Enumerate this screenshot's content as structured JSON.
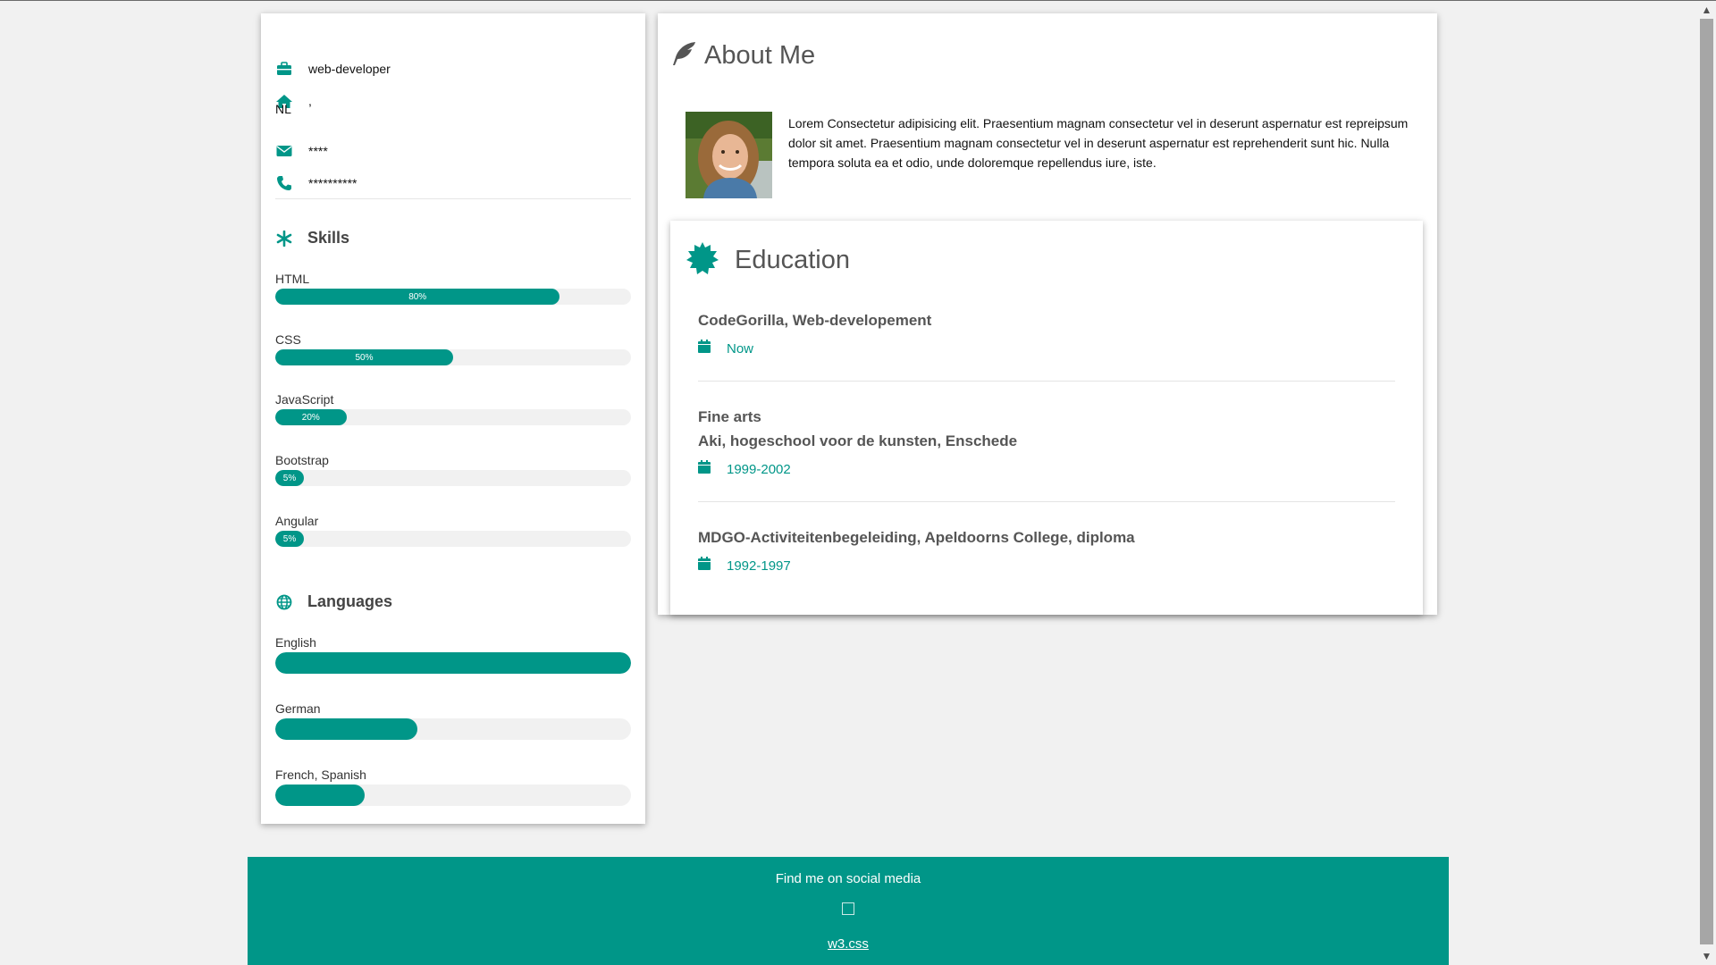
{
  "profile": {
    "job": "web-developer",
    "location_line1": ",",
    "location_line2": "NL",
    "email": "****",
    "phone": "**********"
  },
  "skills": {
    "title": "Skills",
    "items": [
      {
        "label": "HTML",
        "percent": 80,
        "text": "80%"
      },
      {
        "label": "CSS",
        "percent": 50,
        "text": "50%"
      },
      {
        "label": "JavaScript",
        "percent": 20,
        "text": "20%"
      },
      {
        "label": "Bootstrap",
        "percent": 5,
        "text": "5%"
      },
      {
        "label": "Angular",
        "percent": 5,
        "text": "5%"
      }
    ]
  },
  "languages": {
    "title": "Languages",
    "items": [
      {
        "label": "English",
        "percent": 100
      },
      {
        "label": "German",
        "percent": 40
      },
      {
        "label": "French, Spanish",
        "percent": 25
      }
    ]
  },
  "about": {
    "title": "About Me",
    "text": "Lorem Consectetur adipisicing elit. Praesentium magnam consectetur vel in deserunt aspernatur est repreipsum dolor sit amet. Praesentium magnam consectetur vel in deserunt aspernatur est reprehenderit sunt hic. Nulla tempora soluta ea et odio, unde doloremque repellendus iure, iste."
  },
  "education": {
    "title": "Education",
    "entries": [
      {
        "line1": "CodeGorilla, Web-developement",
        "line2": "",
        "date": "Now"
      },
      {
        "line1": "Fine arts",
        "line2": "Aki, hogeschool voor de kunsten, Enschede",
        "date": "1999-2002"
      },
      {
        "line1": "MDGO-Activiteitenbegeleiding, Apeldoorns College, diploma",
        "line2": "",
        "date": "1992-1997"
      }
    ]
  },
  "footer": {
    "title": "Find me on social media",
    "link": "w3.css"
  },
  "colors": {
    "accent": "#009688",
    "background": "#f1f1f1"
  },
  "icons": {
    "job": "briefcase-icon",
    "home": "home-icon",
    "email": "envelope-icon",
    "phone": "phone-icon",
    "skills": "asterisk-icon",
    "languages": "globe-icon",
    "about": "feather-icon",
    "education": "certificate-icon",
    "date": "calendar-icon"
  }
}
